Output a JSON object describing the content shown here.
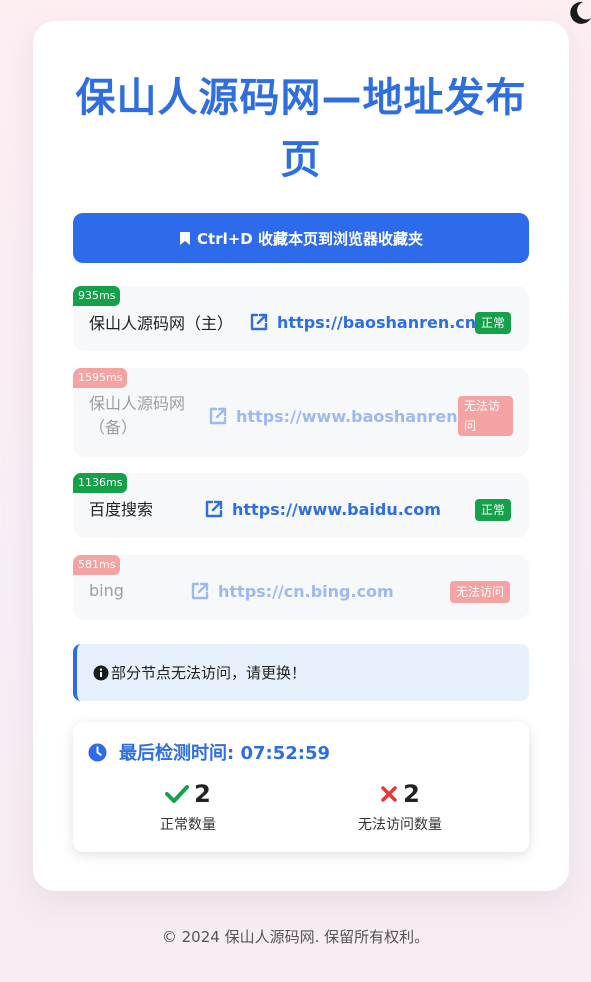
{
  "title": "保山人源码网—地址发布页",
  "bookmark_button": "Ctrl+D 收藏本页到浏览器收藏夹",
  "nodes": [
    {
      "latency": "935ms",
      "name": "保山人源码网（主）",
      "url": "https://baoshanren.cn",
      "status": "正常"
    },
    {
      "latency": "1595ms",
      "name": "保山人源码网（备）",
      "url": "https://www.baoshanren.cn",
      "status": "无法访问"
    },
    {
      "latency": "1136ms",
      "name": "百度搜索",
      "url": "https://www.baidu.com",
      "status": "正常"
    },
    {
      "latency": "581ms",
      "name": "bing",
      "url": "https://cn.bing.com",
      "status": "无法访问"
    }
  ],
  "alert": "部分节点无法访问，请更换！",
  "stats": {
    "last_check": "最后检测时间: 07:52:59",
    "ok_count": "2",
    "ok_label": "正常数量",
    "fail_count": "2",
    "fail_label": "无法访问数量"
  },
  "footer": "© 2024 保山人源码网. 保留所有权利。",
  "colors": {
    "primary": "#2d6bea",
    "ok": "#15a04a",
    "fail": "#f4a2a2",
    "error_icon": "#e53935"
  }
}
